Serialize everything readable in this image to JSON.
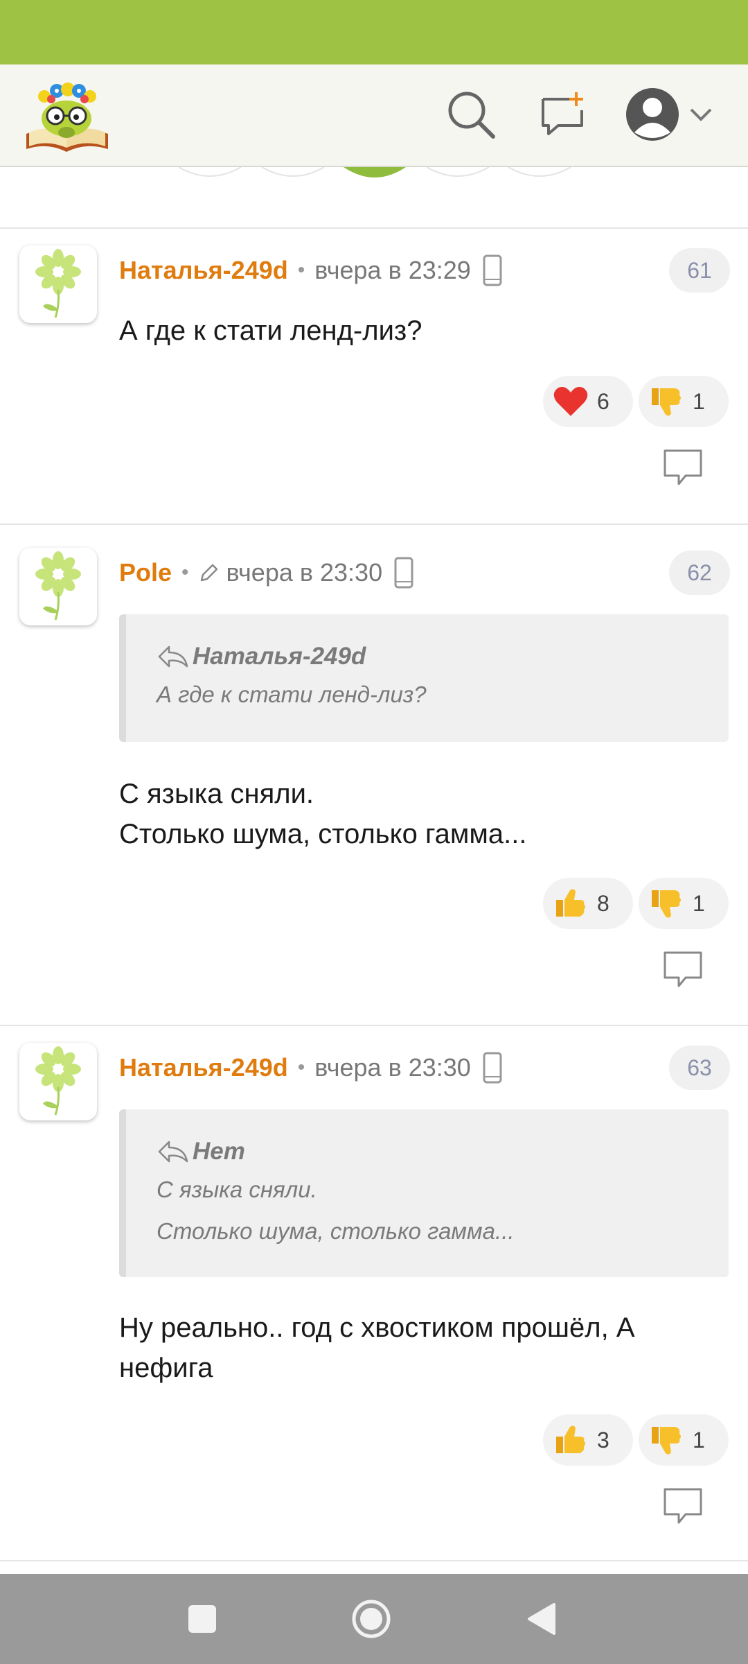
{
  "comments": [
    {
      "author": "Наталья-249d",
      "separator": "•",
      "time": "вчера в 23:29",
      "number": "61",
      "edited": false,
      "quote": null,
      "body": [
        "А где к стати ленд-лиз?"
      ],
      "reactions": [
        {
          "icon": "heart-icon",
          "count": "6"
        },
        {
          "icon": "thumbs-down-icon",
          "count": "1"
        }
      ]
    },
    {
      "author": "Pole",
      "separator": "•",
      "time": "вчера в 23:30",
      "number": "62",
      "edited": true,
      "quote": {
        "author": "Наталья-249d",
        "lines": [
          "А где к стати ленд-лиз?"
        ]
      },
      "body": [
        "С языка сняли.",
        "Столько шума, столько гамма..."
      ],
      "reactions": [
        {
          "icon": "thumbs-up-icon",
          "count": "8"
        },
        {
          "icon": "thumbs-down-icon",
          "count": "1"
        }
      ]
    },
    {
      "author": "Наталья-249d",
      "separator": "•",
      "time": "вчера в 23:30",
      "number": "63",
      "edited": false,
      "quote": {
        "author": "Нет",
        "lines": [
          "С языка сняли.",
          "Столько шума, столько гамма..."
        ]
      },
      "body": [
        "Ну реально.. год с хвостиком прошёл, А",
        "нефига"
      ],
      "reactions": [
        {
          "icon": "thumbs-up-icon",
          "count": "3"
        },
        {
          "icon": "thumbs-down-icon",
          "count": "1"
        }
      ]
    }
  ],
  "colors": {
    "status_bar": "#9dc244",
    "app_bar": "#f6f6f1",
    "author": "#e07b0e",
    "nav_bar": "#9a9a9a"
  },
  "header_icons": [
    "logo-icon",
    "search-icon",
    "new-message-icon",
    "user-avatar-icon",
    "chevron-down-icon"
  ],
  "nav_icons": [
    "recent-apps-icon",
    "home-icon",
    "back-icon"
  ]
}
